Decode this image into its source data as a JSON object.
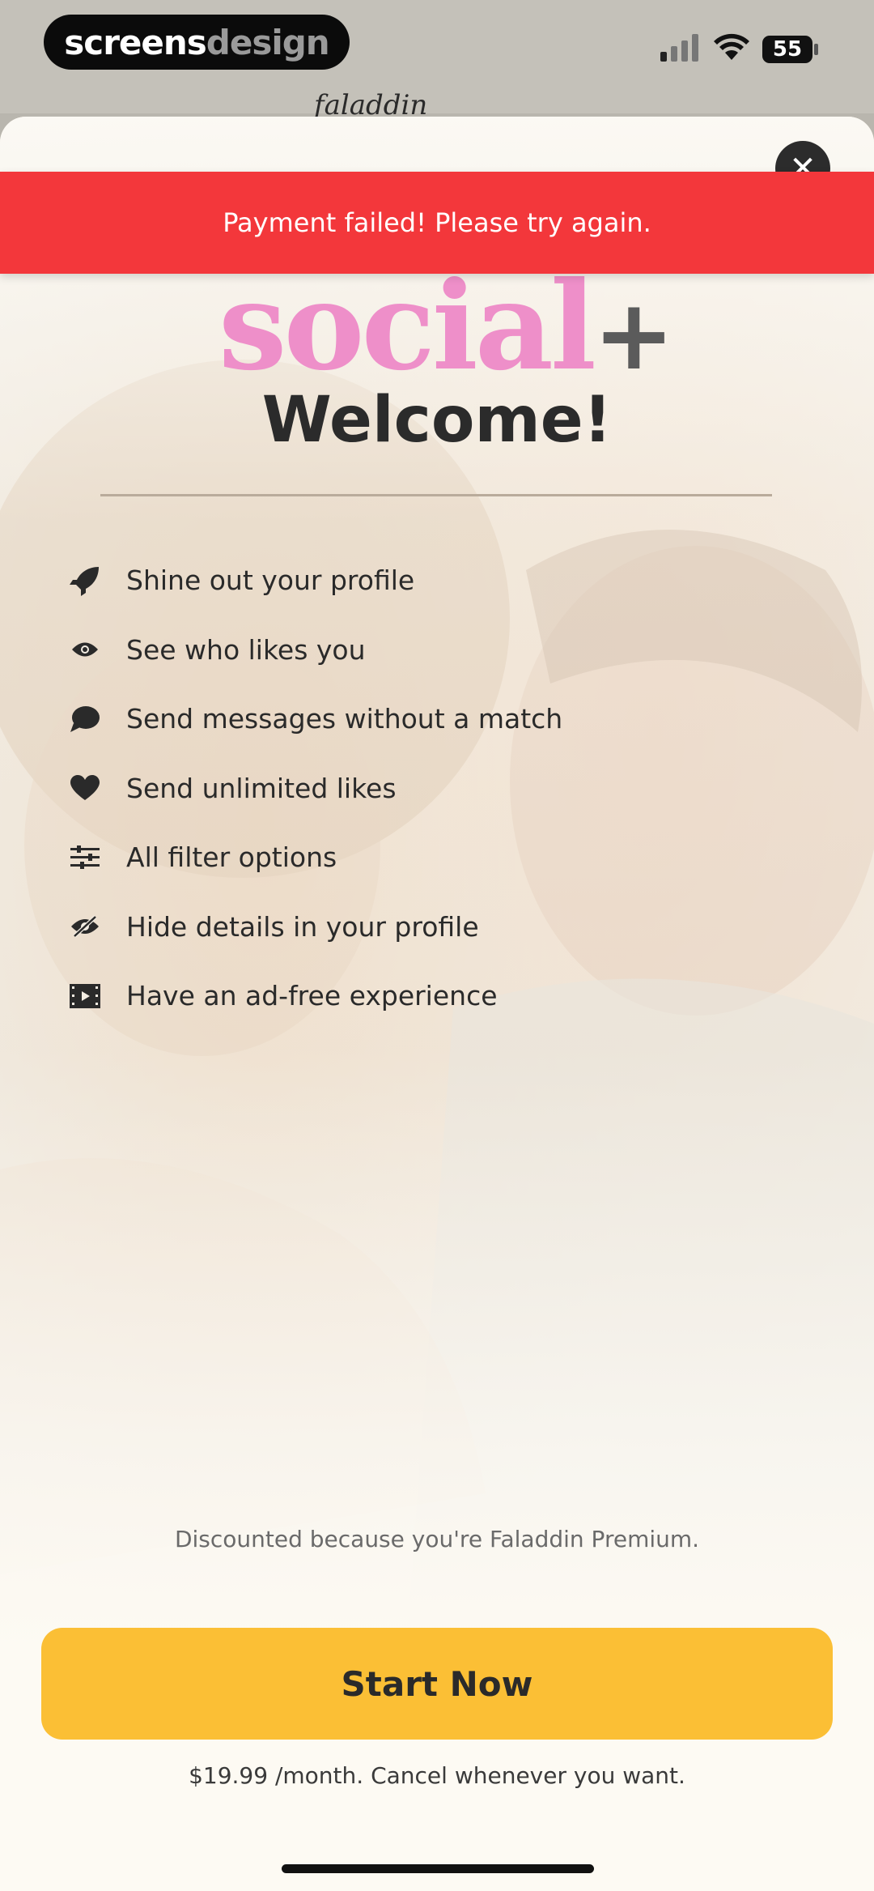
{
  "status_bar": {
    "brand_part1": "screens",
    "brand_part2": "design",
    "battery": "55",
    "behind_logo": "faladdin"
  },
  "banner": {
    "message": "Payment failed! Please try again."
  },
  "paywall": {
    "logo_text": "social",
    "logo_plus": "+",
    "title": "Welcome!",
    "features": [
      {
        "icon": "rocket-icon",
        "label": "Shine out your profile"
      },
      {
        "icon": "eye-icon",
        "label": "See who likes you"
      },
      {
        "icon": "chat-bubble-icon",
        "label": "Send messages without a match"
      },
      {
        "icon": "heart-icon",
        "label": "Send unlimited likes"
      },
      {
        "icon": "sliders-icon",
        "label": "All filter options"
      },
      {
        "icon": "eye-slash-icon",
        "label": "Hide details in your profile"
      },
      {
        "icon": "film-icon",
        "label": "Have an ad-free experience"
      }
    ],
    "discount_note": "Discounted because you're Faladdin Premium.",
    "cta_label": "Start Now",
    "price_note": "$19.99 /month. Cancel whenever you want."
  },
  "colors": {
    "banner": "#f3373b",
    "cta": "#fbbf35",
    "logo_pink": "#ee8fc9"
  }
}
